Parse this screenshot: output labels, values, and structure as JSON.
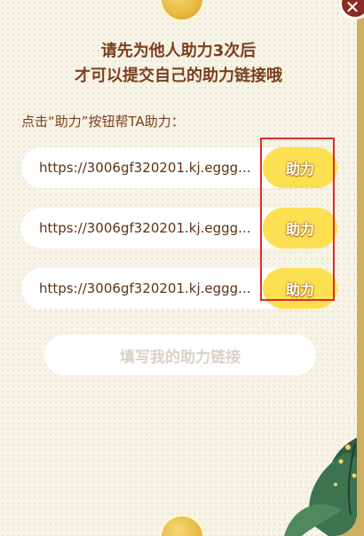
{
  "dialog": {
    "title_line1": "请先为他人助力3次后",
    "title_line2": "才可以提交自己的助力链接哦",
    "hint": "点击“助力”按钮帮TA助力：",
    "close_symbol": "✕"
  },
  "links": [
    {
      "url": "https://3006gf320201.kj.eggg...",
      "button": "助力"
    },
    {
      "url": "https://3006gf320201.kj.eggg...",
      "button": "助力"
    },
    {
      "url": "https://3006gf320201.kj.eggg...",
      "button": "助力"
    }
  ],
  "fill_button": "填写我的助力链接",
  "colors": {
    "title_brown": "#7a3f1c",
    "button_yellow": "#fde052",
    "highlight_red": "#e02b2b",
    "panel_bg": "#f7f4e7"
  }
}
